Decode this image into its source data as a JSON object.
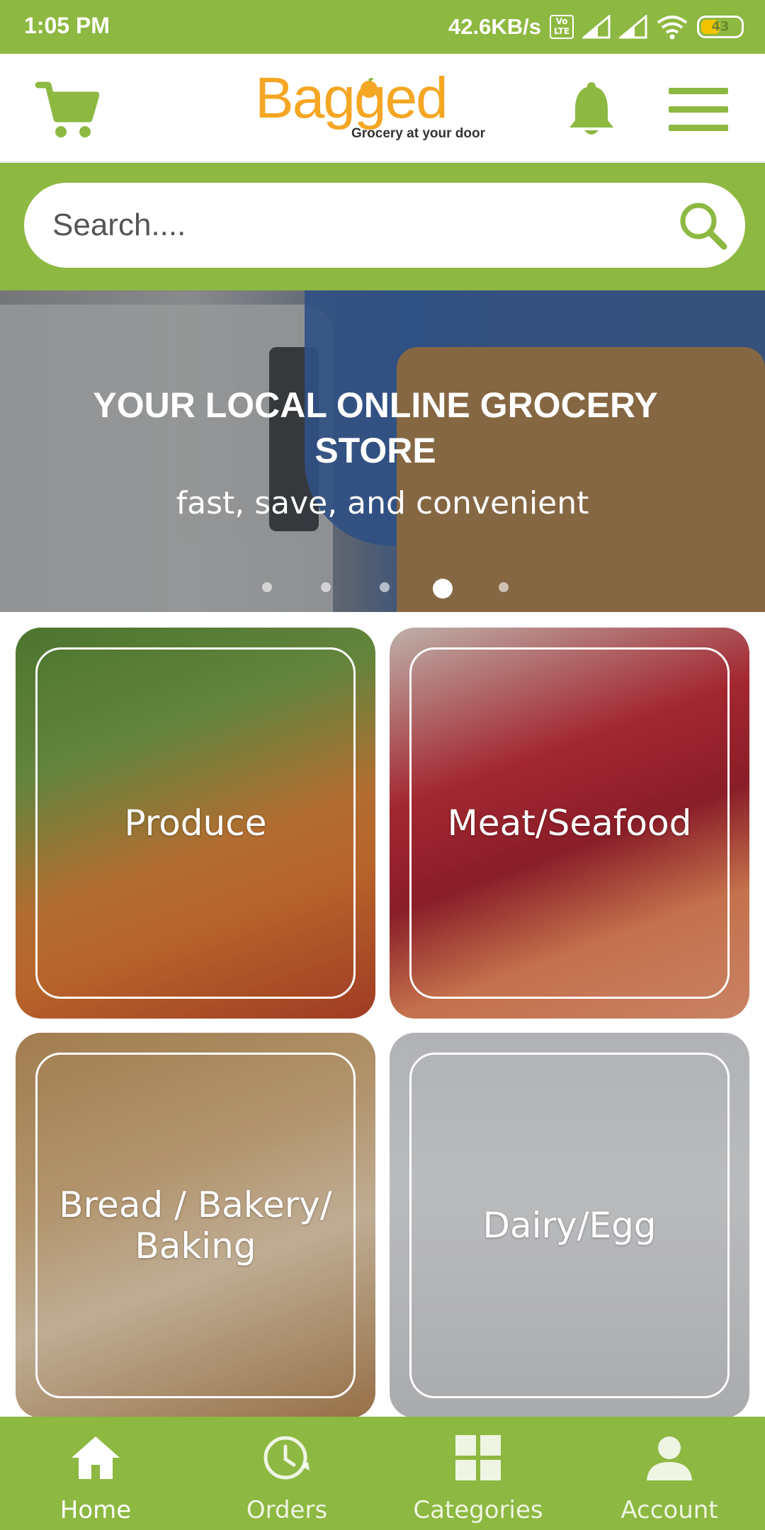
{
  "status_bar": {
    "time": "1:05 PM",
    "network_speed": "42.6KB/s",
    "volte": "Vo LTE",
    "battery": "43"
  },
  "header": {
    "logo_text": "Bagged",
    "tagline": "Grocery at your door",
    "icons": [
      "cart-icon",
      "bell-icon",
      "hamburger-menu-icon"
    ],
    "brand_color": "#8db841",
    "logo_color": "#f5a623"
  },
  "search": {
    "placeholder": "Search....",
    "icon": "search-icon"
  },
  "banner": {
    "title": "YOUR LOCAL ONLINE GROCERY STORE",
    "subtitle": "fast, save, and convenient",
    "slide_count": 5,
    "active_slide": 4
  },
  "categories": [
    {
      "label": "Produce"
    },
    {
      "label": "Meat/Seafood"
    },
    {
      "label": "Bread / Bakery/ Baking"
    },
    {
      "label": "Dairy/Egg"
    }
  ],
  "bottom_nav": [
    {
      "label": "Home",
      "icon": "home-icon",
      "active": true
    },
    {
      "label": "Orders",
      "icon": "clock-history-icon",
      "active": false
    },
    {
      "label": "Categories",
      "icon": "grid-icon",
      "active": false
    },
    {
      "label": "Account",
      "icon": "user-icon",
      "active": false
    }
  ]
}
